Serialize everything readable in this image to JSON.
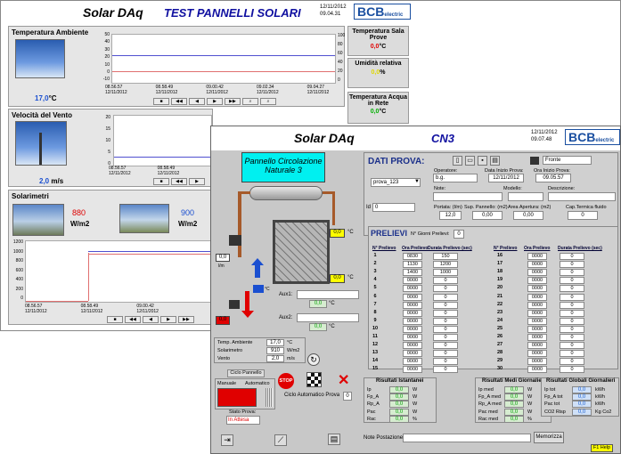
{
  "back_window": {
    "title": "Solar DAq",
    "subtitle": "TEST PANNELLI SOLARI",
    "date": "12/11/2012",
    "time": "09.04.31",
    "logo": "BCB",
    "logo_sub": "electric",
    "temp": {
      "label": "Temperatura Ambiente",
      "value": "17,0",
      "unit": "°C",
      "y_left": [
        "50",
        "40",
        "30",
        "20",
        "10",
        "0",
        "-10"
      ],
      "y_right": [
        "100",
        "80",
        "60",
        "40",
        "20",
        "0"
      ],
      "x": [
        [
          "08.56.57",
          "12/11/2012"
        ],
        [
          "08.58.49",
          "12/11/2012"
        ],
        [
          "09.00.42",
          "12/11/2012"
        ],
        [
          "09.02.34",
          "12/11/2012"
        ],
        [
          "09.04.27",
          "12/11/2012"
        ]
      ]
    },
    "wind": {
      "label": "Velocità del Vento",
      "value": "2,0",
      "unit": "m/s",
      "y": [
        "20",
        "15",
        "10",
        "5",
        "0"
      ],
      "x": [
        [
          "08.56.57",
          "12/11/2012"
        ],
        [
          "08.58.49",
          "12/11/2012"
        ]
      ]
    },
    "sol": {
      "label": "Solarimetri",
      "v1": "880",
      "v2": "900",
      "unit": "W/m2",
      "y": [
        "1200",
        "1000",
        "800",
        "600",
        "400",
        "200",
        "0"
      ],
      "x": [
        [
          "08.56.57",
          "12/11/2012"
        ],
        [
          "08.58.49",
          "12/11/2012"
        ],
        [
          "09.00.42",
          "12/11/2012"
        ]
      ]
    },
    "right": [
      {
        "label": "Temperatura Sala Prove",
        "value": "0,0",
        "unit": "°C",
        "color": "#e00000"
      },
      {
        "label": "Umidità relativa",
        "value": "0,0",
        "unit": "%",
        "color": "#e8e000"
      },
      {
        "label": "Temperatura Acqua in Rete",
        "value": "0,0",
        "unit": "°C",
        "color": "#00b000"
      }
    ]
  },
  "front_window": {
    "title": "Solar DAq",
    "code": "CN3",
    "date": "12/11/2012",
    "time": "09.07.48",
    "logo": "BCB",
    "logo_sub": "electric",
    "panel_label": "Pannello Circolazione Naturale 3",
    "dati": {
      "title": "DATI PROVA:",
      "front": "Fronte",
      "prova": "prova_123",
      "id_label": "Id",
      "id": "0",
      "operatore_l": "Operatore:",
      "operatore": "b.g.",
      "data_l": "Data Inizio Prova:",
      "data": "12/11/2012",
      "ora_l": "Ora Inizio Prova:",
      "ora": "09.05.57",
      "note_l": "Note:",
      "modello_l": "Modello:",
      "descr_l": "Descrizione:",
      "portata_l": "Portata: (l/m)",
      "portata": "12,0",
      "sup_l": "Sup. Pannello: (m2)",
      "sup": "0,00",
      "area_l": "Area Apertura: (m2)",
      "area": "0,00",
      "cap_l": "Cap.Termica fluido",
      "cap": "0"
    },
    "prelievi": {
      "title": "PRELIEVI",
      "n_label": "N° Giorni Prelievi:",
      "n": "0",
      "h1": "N° Prelievo",
      "h2": "Ora Prelievo",
      "h3": "Durata Prelievo (sec)",
      "left": [
        [
          "1",
          "0830",
          "150"
        ],
        [
          "2",
          "1130",
          "1200"
        ],
        [
          "3",
          "1400",
          "1000"
        ],
        [
          "4",
          "0000",
          "0"
        ],
        [
          "5",
          "0000",
          "0"
        ],
        [
          "6",
          "0000",
          "0"
        ],
        [
          "7",
          "0000",
          "0"
        ],
        [
          "8",
          "0000",
          "0"
        ],
        [
          "9",
          "0000",
          "0"
        ],
        [
          "10",
          "0000",
          "0"
        ],
        [
          "11",
          "0000",
          "0"
        ],
        [
          "12",
          "0000",
          "0"
        ],
        [
          "13",
          "0000",
          "0"
        ],
        [
          "14",
          "0000",
          "0"
        ],
        [
          "15",
          "0000",
          "0"
        ]
      ],
      "right": [
        [
          "16",
          "0000",
          "0"
        ],
        [
          "17",
          "0000",
          "0"
        ],
        [
          "18",
          "0000",
          "0"
        ],
        [
          "19",
          "0000",
          "0"
        ],
        [
          "20",
          "0000",
          "0"
        ],
        [
          "21",
          "0000",
          "0"
        ],
        [
          "22",
          "0000",
          "0"
        ],
        [
          "23",
          "0000",
          "0"
        ],
        [
          "24",
          "0000",
          "0"
        ],
        [
          "25",
          "0000",
          "0"
        ],
        [
          "26",
          "0000",
          "0"
        ],
        [
          "27",
          "0000",
          "0"
        ],
        [
          "28",
          "0000",
          "0"
        ],
        [
          "29",
          "0000",
          "0"
        ],
        [
          "30",
          "0000",
          "0"
        ]
      ]
    },
    "diag": {
      "t_top": "0,0",
      "t_mid": "0,0",
      "flow": "0,0",
      "flow_unit": "l/m",
      "t_blue": "°C",
      "t_red": "0,0",
      "aux1": "Aux1:",
      "aux1_v": "0,0",
      "aux2": "Aux2:",
      "aux2_v": "0,0",
      "c": "°C"
    },
    "summary": [
      [
        "Temp. Ambiente",
        "17,0",
        "°C"
      ],
      [
        "Solarimetro",
        "910",
        "W/m2"
      ],
      [
        "Vento",
        "2,0",
        "m/s"
      ]
    ],
    "ciclo": {
      "title": "Ciclo Pannello",
      "manuale": "Manuale",
      "auto": "Automatico",
      "stato_l": "Stato Prova:",
      "stato": "In Attesa",
      "auto_label": "Ciclo Automatico Prova",
      "auto_v": "0",
      "stop": "STOP"
    },
    "ist": {
      "title": "Risultati Istantanei",
      "rows": [
        [
          "Ip",
          "0,0",
          "W"
        ],
        [
          "Fp_A",
          "0,0",
          "W"
        ],
        [
          "Rp_A",
          "0,0",
          "W"
        ],
        [
          "Pac",
          "0,0",
          "W"
        ],
        [
          "Rac",
          "0,0",
          "%"
        ]
      ]
    },
    "medi": {
      "title": "Risultati Medi Giornalieri",
      "rows": [
        [
          "Ip med",
          "0,0",
          "W"
        ],
        [
          "Fp_A med",
          "0,0",
          "W"
        ],
        [
          "Rp_A med",
          "0,0",
          "W"
        ],
        [
          "Pac med",
          "0,0",
          "W"
        ],
        [
          "Rac med",
          "0,0",
          "%"
        ]
      ]
    },
    "glob": {
      "title": "Risultati Globali Giornalieri",
      "rows": [
        [
          "Ip tot",
          "0,0",
          "kWh"
        ],
        [
          "Fp_A tot",
          "0,0",
          "kWh"
        ],
        [
          "Pac tot",
          "0,0",
          "kWh"
        ],
        [
          "CO2 Risp",
          "0,0",
          "Kg Co2"
        ]
      ]
    },
    "note_l": "Note Postazione",
    "memorizza": "Memorizza",
    "help": "F1 Help"
  }
}
